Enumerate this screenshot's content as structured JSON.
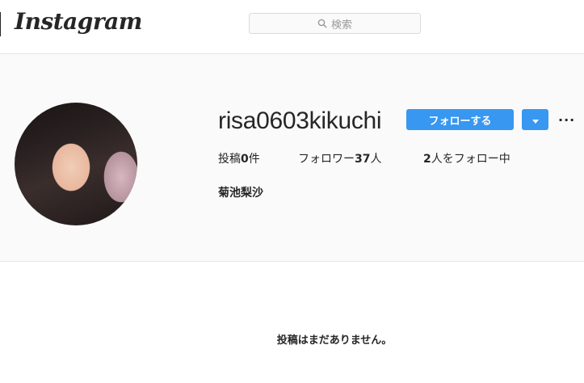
{
  "header": {
    "logo": "Instagram",
    "search_placeholder": "検索"
  },
  "profile": {
    "username": "risa0603kikuchi",
    "follow_label": "フォローする",
    "more_label": "···",
    "stats": {
      "posts_label": "投稿",
      "posts_count": "0",
      "posts_suffix": "件",
      "followers_label": "フォロワー",
      "followers_count": "37",
      "followers_suffix": "人",
      "following_count": "2",
      "following_label": "人をフォロー中"
    },
    "full_name": "菊池梨沙"
  },
  "posts": {
    "empty_message": "投稿はまだありません。"
  },
  "colors": {
    "accent": "#3897f0",
    "background": "#fafafa",
    "text": "#262626"
  }
}
